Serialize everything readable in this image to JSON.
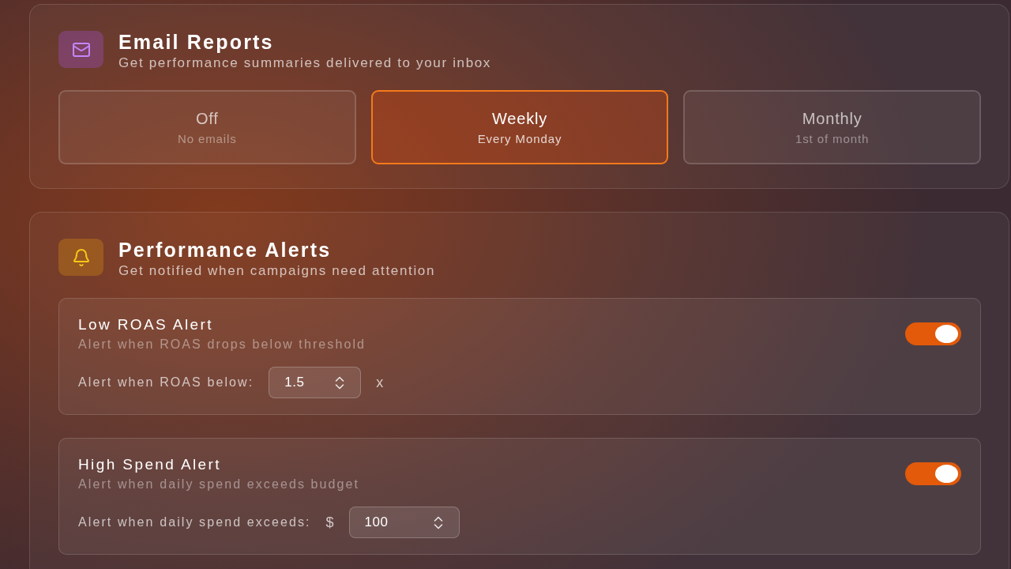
{
  "email_reports": {
    "title": "Email Reports",
    "subtitle": "Get performance summaries delivered to your inbox",
    "options": [
      {
        "label": "Off",
        "description": "No emails",
        "selected": false
      },
      {
        "label": "Weekly",
        "description": "Every Monday",
        "selected": true
      },
      {
        "label": "Monthly",
        "description": "1st of month",
        "selected": false
      }
    ]
  },
  "performance_alerts": {
    "title": "Performance Alerts",
    "subtitle": "Get notified when campaigns need attention",
    "alerts": [
      {
        "title": "Low ROAS Alert",
        "description": "Alert when ROAS drops below threshold",
        "on": true,
        "threshold": {
          "label": "Alert when ROAS below:",
          "value": "1.5",
          "suffix": "x"
        }
      },
      {
        "title": "High Spend Alert",
        "description": "Alert when daily spend exceeds budget",
        "on": true,
        "threshold": {
          "label": "Alert when daily spend exceeds:",
          "prefix": "$",
          "value": "100"
        }
      }
    ]
  }
}
